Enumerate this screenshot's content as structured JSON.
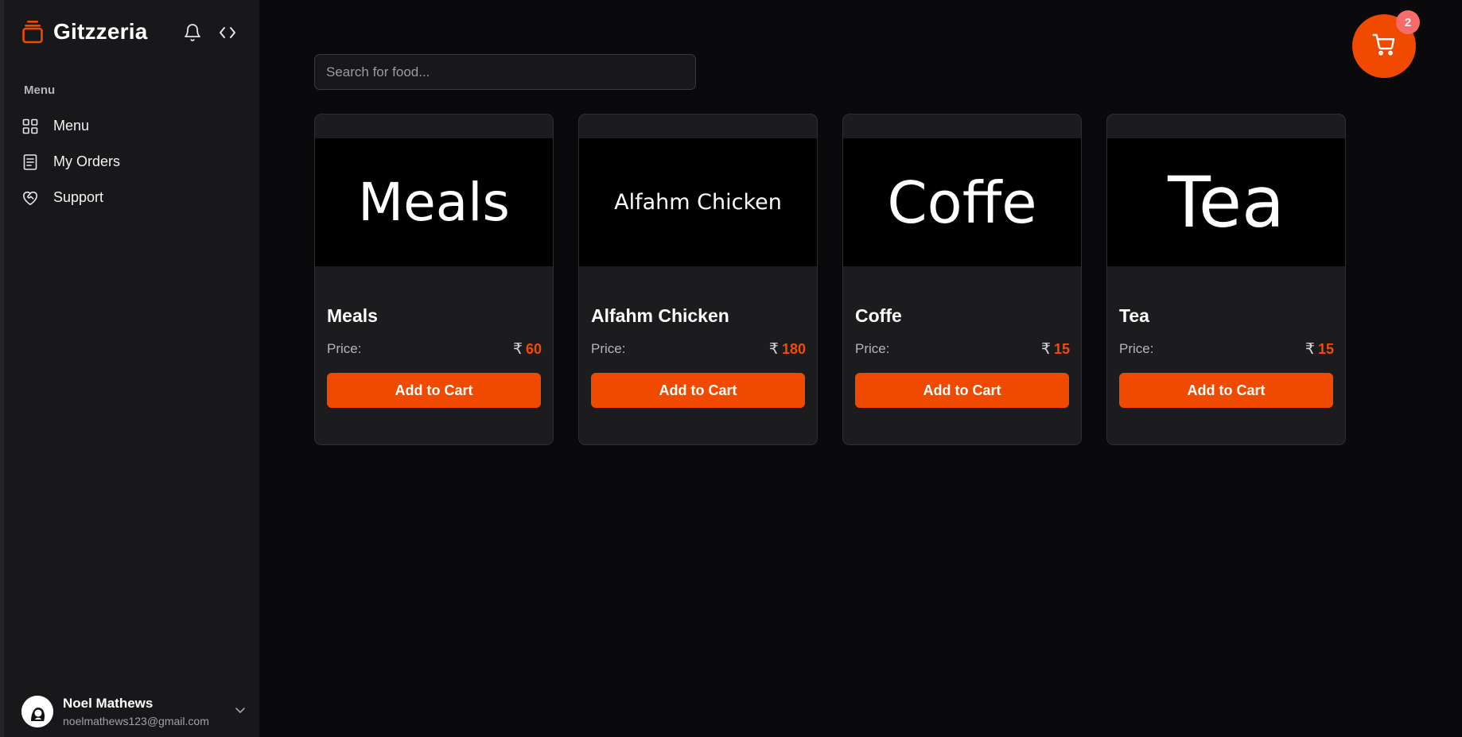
{
  "app": {
    "brand_name": "Gitzzeria",
    "accent_color": "#f04a00"
  },
  "header": {
    "icons": [
      "bell-icon",
      "code-icon"
    ]
  },
  "sidebar": {
    "section_label": "Menu",
    "items": [
      {
        "label": "Menu",
        "icon": "grid-icon"
      },
      {
        "label": "My Orders",
        "icon": "receipt-icon"
      },
      {
        "label": "Support",
        "icon": "heart-handshake-icon"
      }
    ]
  },
  "user": {
    "name": "Noel Mathews",
    "email": "noelmathews123@gmail.com"
  },
  "search": {
    "placeholder": "Search for food..."
  },
  "cart": {
    "count": "2",
    "icon": "shopping-cart-icon"
  },
  "products": [
    {
      "image_text": "Meals",
      "name": "Meals",
      "price_label": "Price:",
      "currency": "₹",
      "price": "60",
      "button": "Add to Cart"
    },
    {
      "image_text": "Alfahm Chicken",
      "name": "Alfahm Chicken",
      "price_label": "Price:",
      "currency": "₹",
      "price": "180",
      "button": "Add to Cart"
    },
    {
      "image_text": "Coffe",
      "name": "Coffe",
      "price_label": "Price:",
      "currency": "₹",
      "price": "15",
      "button": "Add to Cart"
    },
    {
      "image_text": "Tea",
      "name": "Tea",
      "price_label": "Price:",
      "currency": "₹",
      "price": "15",
      "button": "Add to Cart"
    }
  ]
}
